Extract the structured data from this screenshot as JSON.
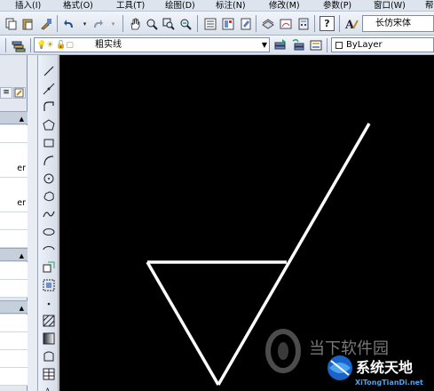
{
  "menubar": {
    "items": [
      {
        "label": "插入(I)"
      },
      {
        "label": "格式(O)"
      },
      {
        "label": "工具(T)"
      },
      {
        "label": "绘图(D)"
      },
      {
        "label": "标注(N)"
      },
      {
        "label": "修改(M)"
      },
      {
        "label": "参数(P)"
      },
      {
        "label": "窗口(W)"
      },
      {
        "label": "帮"
      }
    ]
  },
  "toolbar": {
    "font_name": "长仿宋体",
    "help_label": "?"
  },
  "layers": {
    "current_layer": "粗实线",
    "color": "ByLayer"
  },
  "palette": {
    "rows": [
      {
        "label": "er"
      },
      {
        "label": "er"
      }
    ]
  },
  "watermark": {
    "title": "当下软件园",
    "brand": "系统天地",
    "url": "XiTongTianDi.net"
  },
  "colors": {
    "canvas": "#000000",
    "lines": "#ffffff",
    "watermark_blue": "#1a63c8"
  }
}
